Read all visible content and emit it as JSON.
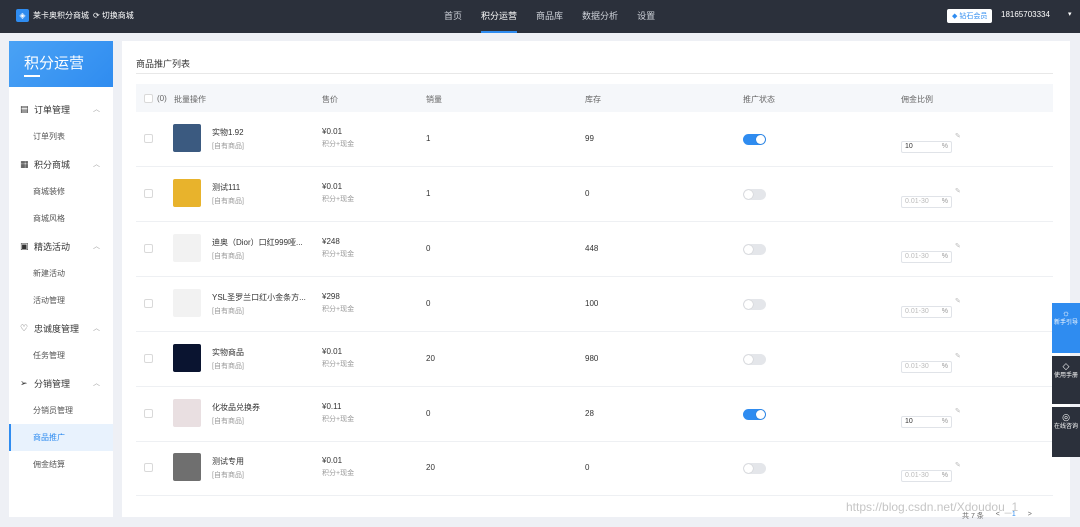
{
  "topbar": {
    "logo_text": "莱卡奥积分商城",
    "switch_label": "切换商城",
    "nav": [
      {
        "label": "首页"
      },
      {
        "label": "积分运营"
      },
      {
        "label": "商品库"
      },
      {
        "label": "数据分析"
      },
      {
        "label": "设置"
      }
    ],
    "active_nav": "积分运营",
    "vip_label": "钻石会员",
    "phone": "18165703334"
  },
  "sidebar": {
    "title": "积分运营",
    "groups": [
      {
        "label": "订单管理",
        "icon": "order-icon",
        "items": [
          {
            "label": "订单列表"
          }
        ]
      },
      {
        "label": "积分商城",
        "icon": "mall-icon",
        "items": [
          {
            "label": "商城装修"
          },
          {
            "label": "商城风格"
          }
        ]
      },
      {
        "label": "精选活动",
        "icon": "gift-icon",
        "items": [
          {
            "label": "新建活动"
          },
          {
            "label": "活动管理"
          }
        ]
      },
      {
        "label": "忠诚度管理",
        "icon": "heart-icon",
        "items": [
          {
            "label": "任务管理"
          }
        ]
      },
      {
        "label": "分销管理",
        "icon": "send-icon",
        "items": [
          {
            "label": "分销员管理"
          },
          {
            "label": "商品推广"
          },
          {
            "label": "佣金结算"
          }
        ]
      }
    ],
    "active_item": "商品推广"
  },
  "main": {
    "title": "商品推广列表",
    "header": {
      "count": "(0)",
      "batch": "批量操作",
      "price": "售价",
      "sales": "销量",
      "stock": "库存",
      "status": "推广状态",
      "commission": "佣金比例"
    },
    "rows": [
      {
        "name": "实物1.92",
        "source": "[自有商品]",
        "price": "¥0.01",
        "pay": "积分+现金",
        "sales": "1",
        "stock": "99",
        "on": true,
        "commission": "10",
        "thumb": "#3b5a80"
      },
      {
        "name": "测试111",
        "source": "[自有商品]",
        "price": "¥0.01",
        "pay": "积分+现金",
        "sales": "1",
        "stock": "0",
        "on": false,
        "commission": "",
        "thumb": "#e8b32c"
      },
      {
        "name": "迪奥（Dior）口红999哑...",
        "source": "[自有商品]",
        "price": "¥248",
        "pay": "积分+现金",
        "sales": "0",
        "stock": "448",
        "on": false,
        "commission": "",
        "thumb": "#f2f2f2"
      },
      {
        "name": "YSL圣罗兰口红小金条方...",
        "source": "[自有商品]",
        "price": "¥298",
        "pay": "积分+现金",
        "sales": "0",
        "stock": "100",
        "on": false,
        "commission": "",
        "thumb": "#f2f2f2"
      },
      {
        "name": "实物商品",
        "source": "[自有商品]",
        "price": "¥0.01",
        "pay": "积分+现金",
        "sales": "20",
        "stock": "980",
        "on": false,
        "commission": "",
        "thumb": "#0a1430"
      },
      {
        "name": "化妆品兑换券",
        "source": "[自有商品]",
        "price": "¥0.11",
        "pay": "积分+现金",
        "sales": "0",
        "stock": "28",
        "on": true,
        "commission": "10",
        "thumb": "#e9dfe1"
      },
      {
        "name": "测试专用",
        "source": "[自有商品]",
        "price": "¥0.01",
        "pay": "积分+现金",
        "sales": "20",
        "stock": "0",
        "on": false,
        "commission": "",
        "thumb": "#6f6f6f"
      }
    ],
    "commission_placeholder": "0.01-30",
    "commission_unit": "%",
    "pager": {
      "total": "共 7 条",
      "prev": "<",
      "page": "1",
      "next": ">"
    }
  },
  "floats": [
    {
      "label": "新手引导",
      "icon": "bulb-icon"
    },
    {
      "label": "使用手册",
      "icon": "book-icon"
    },
    {
      "label": "在线咨询",
      "icon": "chat-icon"
    }
  ],
  "watermark": "https://blog.csdn.net/Xdoudou_1"
}
